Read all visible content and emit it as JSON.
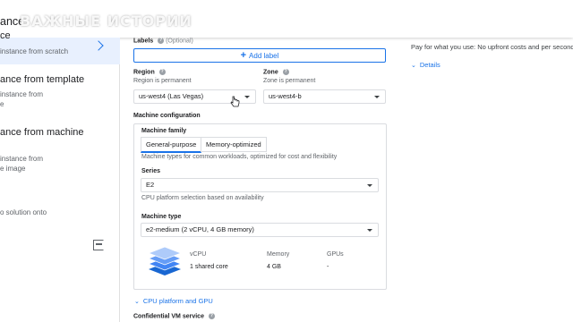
{
  "header": {
    "title": "ance",
    "watermark": "ВАЖНЫЕ ИСТОРИИ"
  },
  "sidebar": {
    "options": [
      {
        "title": "ce",
        "desc": " instance from scratch"
      },
      {
        "title": "ance from template",
        "desc": "instance from",
        "desc2": "e"
      },
      {
        "title": "ance from machine",
        "desc": " instance from",
        "desc2": "e image"
      },
      {
        "title": "",
        "desc": "o solution onto"
      }
    ]
  },
  "labels_section": {
    "label": "Labels",
    "optional": "(Optional)",
    "add_label": "Add label"
  },
  "region": {
    "label": "Region",
    "hint": "Region is permanent",
    "value": "us-west4 (Las Vegas)"
  },
  "zone": {
    "label": "Zone",
    "hint": "Zone is permanent",
    "value": "us-west4-b"
  },
  "machine_config": {
    "title": "Machine configuration",
    "family_label": "Machine family",
    "tabs": [
      "General-purpose",
      "Memory-optimized"
    ],
    "family_desc": "Machine types for common workloads, optimized for cost and flexibility",
    "series_label": "Series",
    "series_value": "E2",
    "series_desc": "CPU platform selection based on availability",
    "type_label": "Machine type",
    "type_value": "e2-medium (2 vCPU, 4 GB memory)",
    "specs": {
      "headers": [
        "vCPU",
        "Memory",
        "GPUs"
      ],
      "values": [
        "1 shared core",
        "4 GB",
        "-"
      ]
    }
  },
  "cpu_platform_link": "CPU platform and GPU",
  "confidential_label": "Confidential VM service",
  "right_panel": {
    "pricing_text": "Pay for what you use: No upfront costs and per second",
    "details_link": "Details"
  },
  "colors": {
    "accent": "#1a73e8",
    "selected_bg": "#e8f0fe"
  }
}
